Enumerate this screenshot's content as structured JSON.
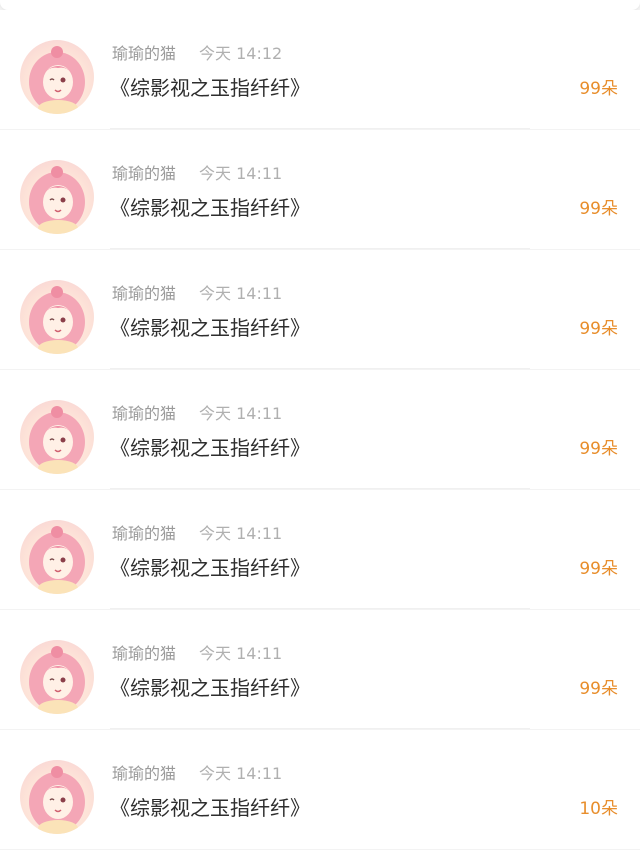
{
  "colors": {
    "accent": "#e88e2c",
    "name_text": "#9a9a9a",
    "time_text": "#b0b0b0",
    "title_text": "#2e2e2e",
    "background": "#f3f3f3"
  },
  "avatar_icon": "anime-girl-avatar",
  "rows": [
    {
      "name": "瑜瑜的猫",
      "time": "今天 14:12",
      "title": "《综影视之玉指纤纤》",
      "count": "99朵"
    },
    {
      "name": "瑜瑜的猫",
      "time": "今天 14:11",
      "title": "《综影视之玉指纤纤》",
      "count": "99朵"
    },
    {
      "name": "瑜瑜的猫",
      "time": "今天 14:11",
      "title": "《综影视之玉指纤纤》",
      "count": "99朵"
    },
    {
      "name": "瑜瑜的猫",
      "time": "今天 14:11",
      "title": "《综影视之玉指纤纤》",
      "count": "99朵"
    },
    {
      "name": "瑜瑜的猫",
      "time": "今天 14:11",
      "title": "《综影视之玉指纤纤》",
      "count": "99朵"
    },
    {
      "name": "瑜瑜的猫",
      "time": "今天 14:11",
      "title": "《综影视之玉指纤纤》",
      "count": "99朵"
    },
    {
      "name": "瑜瑜的猫",
      "time": "今天 14:11",
      "title": "《综影视之玉指纤纤》",
      "count": "10朵"
    }
  ]
}
